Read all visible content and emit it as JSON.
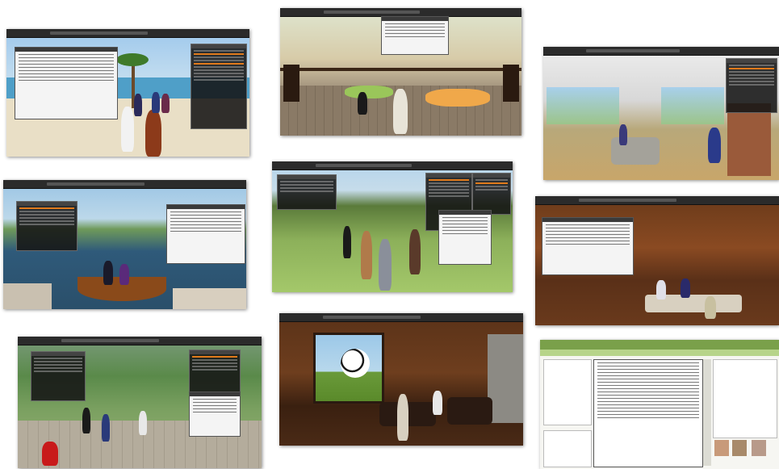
{
  "collage": {
    "panels": [
      {
        "id": "beach-meeting"
      },
      {
        "id": "deck-lounge"
      },
      {
        "id": "modern-room"
      },
      {
        "id": "boat-lake"
      },
      {
        "id": "flower-field"
      },
      {
        "id": "cabin-class"
      },
      {
        "id": "garden-plaza"
      },
      {
        "id": "soccer-room"
      },
      {
        "id": "web-worksheet"
      }
    ]
  },
  "colors": {
    "ui_bar": "#2b2b2b",
    "accent_orange": "#e07a1c",
    "window_dark": "#161616",
    "window_light": "#f4f4f4"
  }
}
